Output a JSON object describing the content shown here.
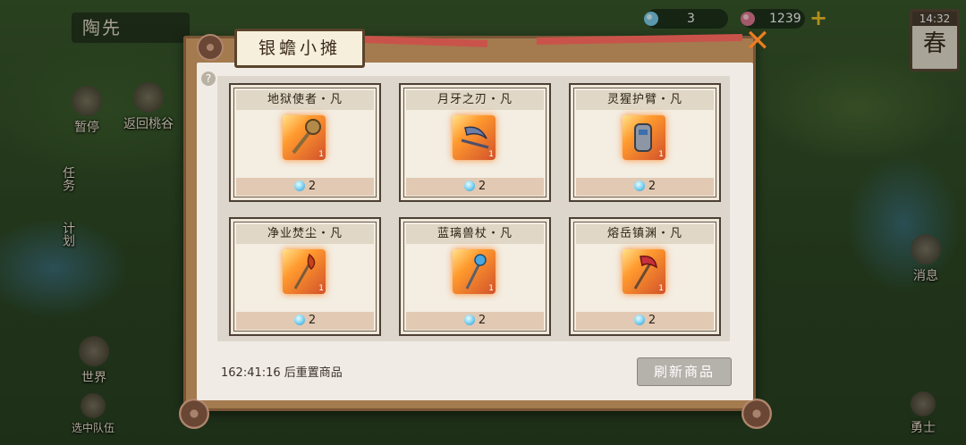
{
  "hud": {
    "player_name": "陶先",
    "pause_label": "暂停",
    "return_label": "返回桃谷",
    "task_label": "任务",
    "plan_label": "计划",
    "world_label": "世界",
    "team_label": "选中队伍",
    "message_label": "消息",
    "hero_label": "勇士"
  },
  "currency": {
    "crystal_count": "3",
    "jade_count": "1239",
    "add_symbol": "+"
  },
  "season": {
    "time": "14:32",
    "name": "春"
  },
  "shop": {
    "title": "银蟾小摊",
    "close_symbol": "✕",
    "help_symbol": "?",
    "items": [
      {
        "name": "地狱使者・凡",
        "level": "1",
        "price": "2",
        "icon": "mace-icon",
        "weapon_color": "#b48a4a"
      },
      {
        "name": "月牙之刃・凡",
        "level": "1",
        "price": "2",
        "icon": "crescent-blade-icon",
        "weapon_color": "#6d7fa8"
      },
      {
        "name": "灵猩护臂・凡",
        "level": "1",
        "price": "2",
        "icon": "bracer-icon",
        "weapon_color": "#8d96a4"
      },
      {
        "name": "净业焚尘・凡",
        "level": "1",
        "price": "2",
        "icon": "torch-staff-icon",
        "weapon_color": "#c2451e"
      },
      {
        "name": "蓝璃兽杖・凡",
        "level": "1",
        "price": "2",
        "icon": "blue-staff-icon",
        "weapon_color": "#4aa7e0"
      },
      {
        "name": "熔岳镇渊・凡",
        "level": "1",
        "price": "2",
        "icon": "axe-icon",
        "weapon_color": "#c8323a"
      }
    ],
    "reset_text": "162:41:16 后重置商品",
    "refresh_label": "刷新商品"
  }
}
